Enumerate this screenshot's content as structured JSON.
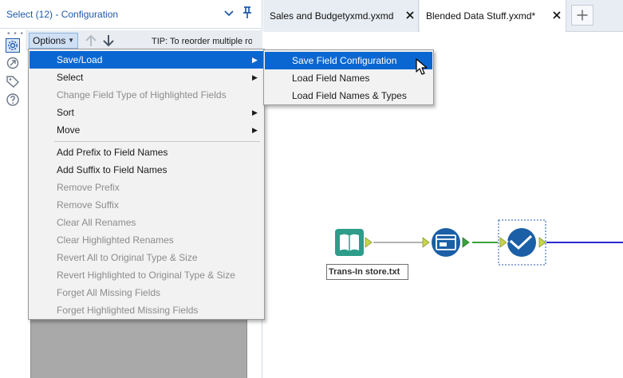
{
  "config_panel": {
    "title": "Select (12) - Configuration",
    "options_label": "Options",
    "tip": "TIP: To reorder multiple ro",
    "rail_dots": "• • •",
    "rail_icons": [
      "gear-icon",
      "link-icon",
      "tag-icon",
      "help-icon"
    ]
  },
  "tabs": [
    {
      "label": "Sales and Budgetyxmd.yxmd",
      "active": false
    },
    {
      "label": "Blended Data Stuff.yxmd*",
      "active": true
    }
  ],
  "options_menu": {
    "items": [
      {
        "label": "Save/Load",
        "submenu": true,
        "state": "highlighted"
      },
      {
        "label": "Select",
        "submenu": true,
        "state": "enabled"
      },
      {
        "label": "Change Field Type of Highlighted Fields",
        "submenu": false,
        "state": "disabled"
      },
      {
        "label": "Sort",
        "submenu": true,
        "state": "enabled"
      },
      {
        "label": "Move",
        "submenu": true,
        "state": "enabled"
      },
      {
        "label": "Add Prefix to Field Names",
        "submenu": false,
        "state": "enabled"
      },
      {
        "label": "Add Suffix to Field Names",
        "submenu": false,
        "state": "enabled"
      },
      {
        "label": "Remove Prefix",
        "submenu": false,
        "state": "disabled"
      },
      {
        "label": "Remove Suffix",
        "submenu": false,
        "state": "disabled"
      },
      {
        "label": "Clear All Renames",
        "submenu": false,
        "state": "disabled"
      },
      {
        "label": "Clear Highlighted Renames",
        "submenu": false,
        "state": "disabled"
      },
      {
        "label": "Revert All to Original Type & Size",
        "submenu": false,
        "state": "disabled"
      },
      {
        "label": "Revert Highlighted to Original Type & Size",
        "submenu": false,
        "state": "disabled"
      },
      {
        "label": "Forget All Missing Fields",
        "submenu": false,
        "state": "disabled"
      },
      {
        "label": "Forget Highlighted Missing Fields",
        "submenu": false,
        "state": "disabled"
      }
    ],
    "submenu_arrow": "▶"
  },
  "saveload_submenu": {
    "items": [
      {
        "label": "Save Field Configuration",
        "state": "highlighted"
      },
      {
        "label": "Load Field Names",
        "state": "enabled"
      },
      {
        "label": "Load Field Names & Types",
        "state": "enabled"
      }
    ]
  },
  "workflow": {
    "input_file_label": "Trans-In store.txt",
    "tools": [
      "book-input-icon",
      "browse-window-icon",
      "select-check-icon"
    ]
  },
  "colors": {
    "accent": "#1f5aa8",
    "highlight": "#0a67d2",
    "input_tool": "#2e9c8a",
    "process_tool": "#1b5fa6",
    "connector_green": "#3aa23a",
    "connector_blue": "#2a2ad0",
    "anchor_yellow": "#c7d64a"
  }
}
